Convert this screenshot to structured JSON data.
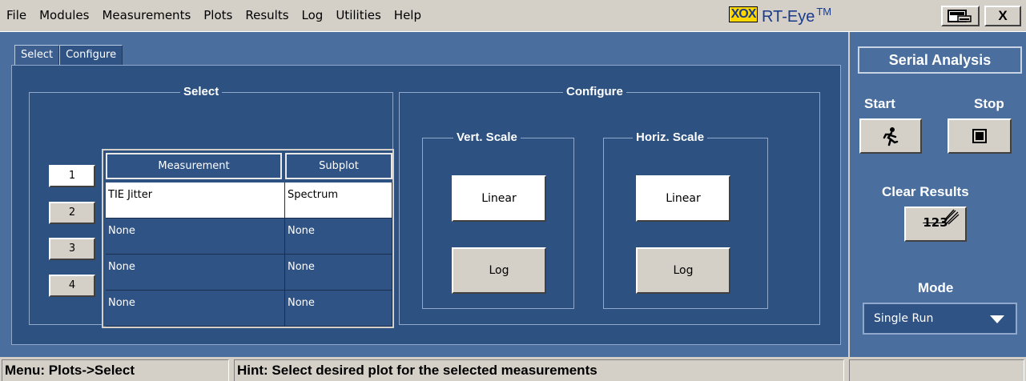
{
  "menubar": {
    "items": [
      "File",
      "Modules",
      "Measurements",
      "Plots",
      "Results",
      "Log",
      "Utilities",
      "Help"
    ],
    "brand_logo": "XOX",
    "brand_name": "RT-Eye",
    "brand_tm": "TM",
    "close_label": "X"
  },
  "tabs": [
    {
      "label": "Select",
      "active": false
    },
    {
      "label": "Configure",
      "active": true
    }
  ],
  "select_group": {
    "title": "Select",
    "headers": {
      "measurement": "Measurement",
      "subplot": "Subplot"
    },
    "rows": [
      {
        "number": "1",
        "measurement": "TIE Jitter",
        "subplot": "Spectrum",
        "selected": true
      },
      {
        "number": "2",
        "measurement": "None",
        "subplot": "None",
        "selected": false
      },
      {
        "number": "3",
        "measurement": "None",
        "subplot": "None",
        "selected": false
      },
      {
        "number": "4",
        "measurement": "None",
        "subplot": "None",
        "selected": false
      }
    ]
  },
  "configure_group": {
    "title": "Configure",
    "vert_scale": {
      "title": "Vert. Scale",
      "linear": "Linear",
      "log": "Log",
      "selected": "Linear"
    },
    "horiz_scale": {
      "title": "Horiz. Scale",
      "linear": "Linear",
      "log": "Log",
      "selected": "Linear"
    }
  },
  "right_panel": {
    "title": "Serial Analysis",
    "start_label": "Start",
    "stop_label": "Stop",
    "clear_results_label": "Clear Results",
    "clear_icon_text": "123",
    "mode_label": "Mode",
    "mode_value": "Single Run"
  },
  "statusbar": {
    "menu": "Menu: Plots->Select",
    "hint": "Hint: Select desired plot for the selected measurements"
  },
  "colors": {
    "panel_bg": "#2d5282",
    "outer_bg": "#4a6e9e",
    "chrome": "#d4d0c8",
    "brand_yellow": "#ffd800",
    "brand_blue": "#1a3a8a"
  }
}
